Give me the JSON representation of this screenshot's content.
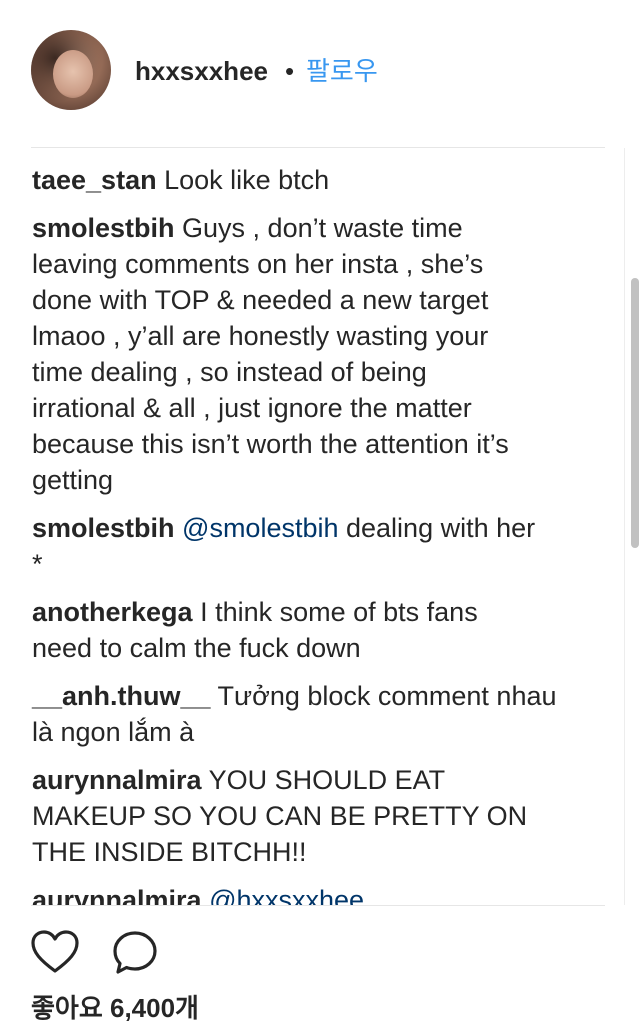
{
  "header": {
    "username": "hxxsxxhee",
    "separator": "•",
    "follow_label": "팔로우"
  },
  "comments": [
    {
      "author": "taee_stan",
      "text": " Look like btch"
    },
    {
      "author": "smolestbih",
      "text": " Guys , don’t waste time\nleaving comments on her insta , she’s\ndone with TOP & needed a new target\nlmaoo , y’all are honestly wasting your\ntime dealing , so instead of being\nirrational & all , just ignore the matter\nbecause this isn’t worth the attention it’s\ngetting"
    },
    {
      "author": "smolestbih",
      "mention": " @smolestbih",
      "text": " dealing with her\n*"
    },
    {
      "author": "anotherkega",
      "text": " I think some of bts fans\nneed to calm the fuck down"
    },
    {
      "author": "__anh.thuw__",
      "text": " Tưởng block comment nhau\nlà ngon lắm à"
    },
    {
      "author": "aurynnalmira",
      "text": " YOU SHOULD EAT\nMAKEUP SO YOU CAN BE PRETTY ON\nTHE INSIDE BITCHH!!"
    },
    {
      "author": "aurynnalmira",
      "mention": " @hxxsxxhee",
      "text": ""
    }
  ],
  "actions": {
    "like_icon": "heart-outline-icon",
    "comment_icon": "comment-bubble-icon"
  },
  "likes": {
    "label": "좋아요 6,400개"
  }
}
